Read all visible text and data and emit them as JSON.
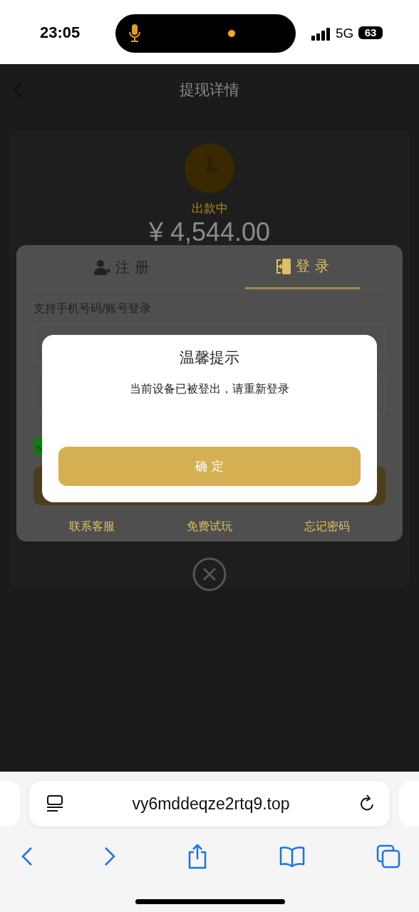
{
  "status_bar": {
    "time": "23:05",
    "network": "5G",
    "battery": "63"
  },
  "page": {
    "title": "提现详情",
    "status": "出款中",
    "amount": "¥ 4,544.00"
  },
  "login_panel": {
    "tabs": [
      {
        "label": "注 册",
        "selected": false
      },
      {
        "label": "登 录",
        "selected": true
      }
    ],
    "hint": "支持手机号码/账号登录",
    "remember": {
      "checked": true
    },
    "links": [
      "联系客服",
      "免费试玩",
      "忘记密码"
    ]
  },
  "dialog": {
    "title": "温馨提示",
    "message": "当前设备已被登出，请重新登录",
    "button": "确 定"
  },
  "browser": {
    "url": "vy6mddeqze2rtq9.top"
  }
}
